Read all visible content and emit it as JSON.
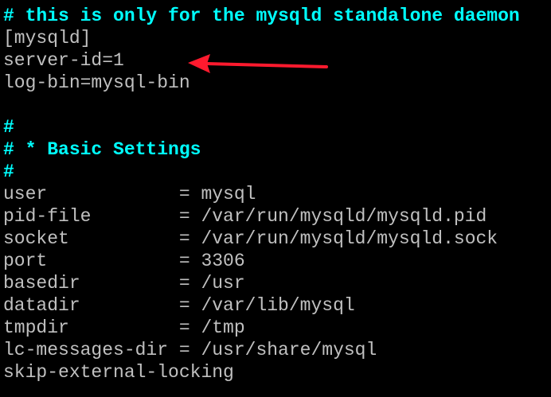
{
  "terminal": {
    "lines": {
      "l0": "# this is only for the mysqld standalone daemon",
      "l1": "[mysqld]",
      "l2": "server-id=1",
      "l3": "log-bin=mysql-bin",
      "l4": "",
      "l5": "#",
      "l6": "# * Basic Settings",
      "l7": "#",
      "l8": "user            = mysql",
      "l9": "pid-file        = /var/run/mysqld/mysqld.pid",
      "l10": "socket          = /var/run/mysqld/mysqld.sock",
      "l11": "port            = 3306",
      "l12": "basedir         = /usr",
      "l13": "datadir         = /var/lib/mysql",
      "l14": "tmpdir          = /tmp",
      "l15": "lc-messages-dir = /usr/share/mysql",
      "l16": "skip-external-locking"
    }
  },
  "colors": {
    "background": "#000000",
    "text": "#c0c0c0",
    "comment": "#00ffff",
    "arrow": "#ff1a2e"
  }
}
